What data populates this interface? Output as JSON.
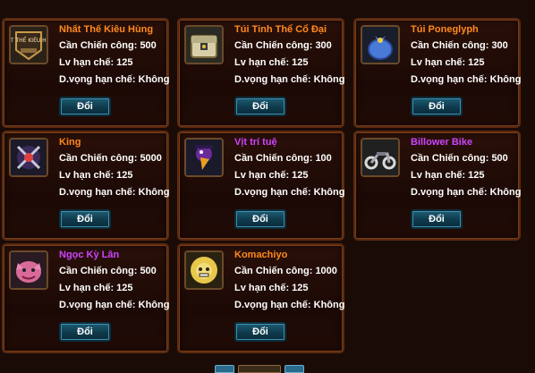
{
  "colors": {
    "orange_name": "#ff8a1c",
    "purple_name": "#cc44ff",
    "text": "#ffffff",
    "button": "#1e5b73"
  },
  "items": [
    {
      "name": "Nhất Thế Kiêu Hùng",
      "name_color": "#ff8a1c",
      "icon": "nhat-the-kieu-hung-icon",
      "icon_text": "NHẤT THẾ KIÊU HÙNG",
      "cost": "Cần Chiến công: 500",
      "level": "Lv hạn chế: 125",
      "rep_label": "D.vọng hạn chế:",
      "rep_value": "Không",
      "button": "Đổi"
    },
    {
      "name": "Túi Tinh Thể Cổ Đại",
      "name_color": "#ff8a1c",
      "icon": "treasure-chest-icon",
      "cost": "Cần Chiến công: 300",
      "level": "Lv hạn chế: 125",
      "rep_label": "D.vọng hạn chế:",
      "rep_value": "Không",
      "button": "Đổi"
    },
    {
      "name": "Túi Poneglyph",
      "name_color": "#ff8a1c",
      "icon": "blue-bag-icon",
      "cost": "Cần Chiến công: 300",
      "level": "Lv hạn chế: 125",
      "rep_label": "D.vọng hạn chế:",
      "rep_value": "Không",
      "button": "Đổi"
    },
    {
      "name": "King",
      "name_color": "#ff8a1c",
      "icon": "king-character-icon",
      "cost": "Cần Chiến công: 5000",
      "level": "Lv hạn chế: 125",
      "rep_label": "D.vọng hạn chế:",
      "rep_value": "Không",
      "button": "Đổi"
    },
    {
      "name": "Vịt trí tuệ",
      "name_color": "#cc44ff",
      "icon": "wise-duck-icon",
      "cost": "Cần Chiến công: 100",
      "level": "Lv hạn chế: 125",
      "rep_label": "D.vọng hạn chế:",
      "rep_value": "Không",
      "button": "Đổi"
    },
    {
      "name": "Billower Bike",
      "name_color": "#cc44ff",
      "icon": "motorbike-icon",
      "cost": "Cần Chiến công: 500",
      "level": "Lv hạn chế: 125",
      "rep_label": "D.vọng hạn chế:",
      "rep_value": "Không",
      "button": "Đổi"
    },
    {
      "name": "Ngọc Kỳ Lân",
      "name_color": "#cc44ff",
      "icon": "pink-dragon-icon",
      "cost": "Cần Chiến công: 500",
      "level": "Lv hạn chế: 125",
      "rep_label": "D.vọng hạn chế:",
      "rep_value": "Không",
      "button": "Đổi"
    },
    {
      "name": "Komachiyo",
      "name_color": "#ff8a1c",
      "icon": "golden-lion-icon",
      "cost": "Cần Chiến công: 1000",
      "level": "Lv hạn chế: 125",
      "rep_label": "D.vọng hạn chế:",
      "rep_value": "Không",
      "button": "Đổi"
    }
  ]
}
